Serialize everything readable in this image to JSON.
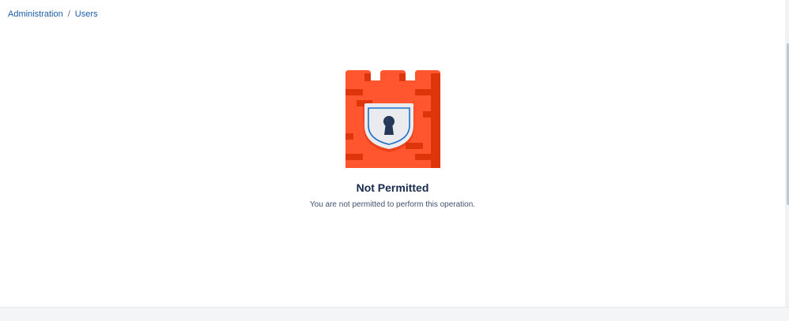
{
  "breadcrumb": {
    "items": [
      {
        "label": "Administration"
      },
      {
        "label": "Users"
      }
    ],
    "separator": "/"
  },
  "empty_state": {
    "illustration_icon": "castle-lock-icon",
    "title": "Not Permitted",
    "description": "You are not permitted to perform this operation."
  },
  "colors": {
    "breadcrumb_link": "#1d5ca6",
    "title": "#172b4d",
    "castle_red": "#ff5630",
    "castle_dark": "#de350b",
    "shield_fill": "#e9ebef",
    "shield_outline": "#1f6fc5",
    "keyhole": "#253858",
    "footer_bg": "#f4f5f7"
  }
}
